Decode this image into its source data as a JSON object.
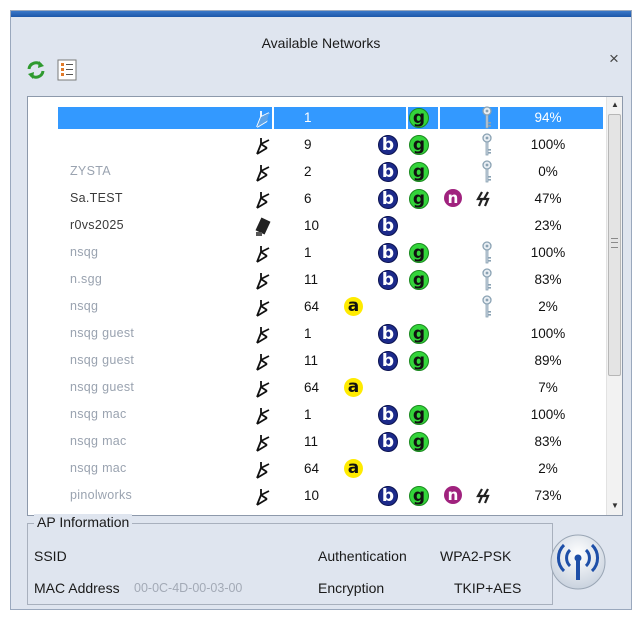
{
  "window": {
    "title": "Available Networks",
    "close_glyph": "×"
  },
  "toolbar": {
    "refresh_icon": "refresh-icon",
    "list_icon": "list-icon"
  },
  "networks": [
    {
      "ssid": "",
      "channel": "1",
      "a": false,
      "b": false,
      "g": true,
      "n": false,
      "mimo": false,
      "key": true,
      "signal": "94%",
      "selected": true,
      "icon": "hand"
    },
    {
      "ssid": "",
      "channel": "9",
      "a": false,
      "b": true,
      "g": true,
      "n": false,
      "mimo": false,
      "key": true,
      "signal": "100%",
      "icon": "hand"
    },
    {
      "ssid": "ZYSTA",
      "channel": "2",
      "a": false,
      "b": true,
      "g": true,
      "n": false,
      "mimo": false,
      "key": true,
      "signal": "0%",
      "icon": "hand"
    },
    {
      "ssid": "Sa.TEST",
      "channel": "6",
      "a": false,
      "b": true,
      "g": true,
      "n": true,
      "mimo": true,
      "key": false,
      "signal": "47%",
      "icon": "hand",
      "dark": true
    },
    {
      "ssid": "r0vs2025",
      "channel": "10",
      "a": false,
      "b": true,
      "g": false,
      "n": false,
      "mimo": false,
      "key": false,
      "signal": "23%",
      "icon": "card",
      "dark": true
    },
    {
      "ssid": "nsqg",
      "channel": "1",
      "a": false,
      "b": true,
      "g": true,
      "n": false,
      "mimo": false,
      "key": true,
      "signal": "100%",
      "icon": "hand"
    },
    {
      "ssid": "n.sgg",
      "channel": "11",
      "a": false,
      "b": true,
      "g": true,
      "n": false,
      "mimo": false,
      "key": true,
      "signal": "83%",
      "icon": "hand"
    },
    {
      "ssid": "nsqg",
      "channel": "64",
      "a": true,
      "b": false,
      "g": false,
      "n": false,
      "mimo": false,
      "key": true,
      "signal": "2%",
      "icon": "hand"
    },
    {
      "ssid": "nsqg guest",
      "channel": "1",
      "a": false,
      "b": true,
      "g": true,
      "n": false,
      "mimo": false,
      "key": false,
      "signal": "100%",
      "icon": "hand"
    },
    {
      "ssid": "nsqg guest",
      "channel": "11",
      "a": false,
      "b": true,
      "g": true,
      "n": false,
      "mimo": false,
      "key": false,
      "signal": "89%",
      "icon": "hand"
    },
    {
      "ssid": "nsqg guest",
      "channel": "64",
      "a": true,
      "b": false,
      "g": false,
      "n": false,
      "mimo": false,
      "key": false,
      "signal": "7%",
      "icon": "hand"
    },
    {
      "ssid": "nsqg mac",
      "channel": "1",
      "a": false,
      "b": true,
      "g": true,
      "n": false,
      "mimo": false,
      "key": false,
      "signal": "100%",
      "icon": "hand"
    },
    {
      "ssid": "nsqg mac",
      "channel": "11",
      "a": false,
      "b": true,
      "g": true,
      "n": false,
      "mimo": false,
      "key": false,
      "signal": "83%",
      "icon": "hand"
    },
    {
      "ssid": "nsqg mac",
      "channel": "64",
      "a": true,
      "b": false,
      "g": false,
      "n": false,
      "mimo": false,
      "key": false,
      "signal": "2%",
      "icon": "hand"
    },
    {
      "ssid": "pinolworks",
      "channel": "10",
      "a": false,
      "b": true,
      "g": true,
      "n": true,
      "mimo": true,
      "key": false,
      "signal": "73%",
      "icon": "hand"
    }
  ],
  "badges": {
    "a": "a",
    "b": "b",
    "g": "g",
    "n": "n"
  },
  "ap_info": {
    "legend": "AP Information",
    "ssid_label": "SSID",
    "mac_label": "MAC Address",
    "mac_value": "00-0C-4D-00-03-00",
    "auth_label": "Authentication",
    "auth_value": "WPA2-PSK",
    "enc_label": "Encryption",
    "enc_value": "TKIP+AES"
  },
  "colors": {
    "selection": "#3399ff",
    "badge_a": "#ffeb00",
    "badge_b": "#1c2a8a",
    "badge_g": "#33d43a",
    "badge_n": "#a0227e"
  }
}
